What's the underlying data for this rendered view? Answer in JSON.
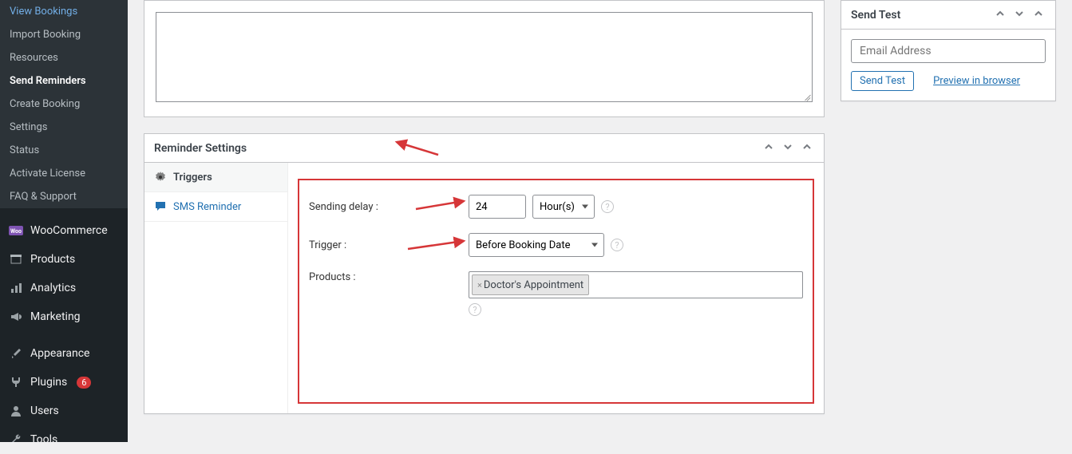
{
  "sidebar": {
    "submenu": [
      "View Bookings",
      "Import Booking",
      "Resources",
      "Send Reminders",
      "Create Booking",
      "Settings",
      "Status",
      "Activate License",
      "FAQ & Support"
    ],
    "active_submenu": "Send Reminders",
    "main_items": [
      {
        "label": "WooCommerce",
        "icon": "woo"
      },
      {
        "label": "Products",
        "icon": "products"
      },
      {
        "label": "Analytics",
        "icon": "analytics"
      },
      {
        "label": "Marketing",
        "icon": "marketing"
      }
    ],
    "main_items2": [
      {
        "label": "Appearance",
        "icon": "appearance"
      },
      {
        "label": "Plugins",
        "icon": "plugins",
        "badge": "6"
      },
      {
        "label": "Users",
        "icon": "users"
      },
      {
        "label": "Tools",
        "icon": "tools"
      }
    ]
  },
  "reminder": {
    "title": "Reminder Settings",
    "tabs": {
      "triggers": "Triggers",
      "sms": "SMS Reminder"
    },
    "form": {
      "sending_delay_label": "Sending delay :",
      "sending_delay_value": "24",
      "sending_delay_unit": "Hour(s)",
      "trigger_label": "Trigger :",
      "trigger_value": "Before Booking Date",
      "products_label": "Products :",
      "product_tag": "Doctor's Appointment"
    }
  },
  "send_test": {
    "title": "Send Test",
    "placeholder": "Email Address",
    "button": "Send Test",
    "preview": "Preview in browser"
  }
}
